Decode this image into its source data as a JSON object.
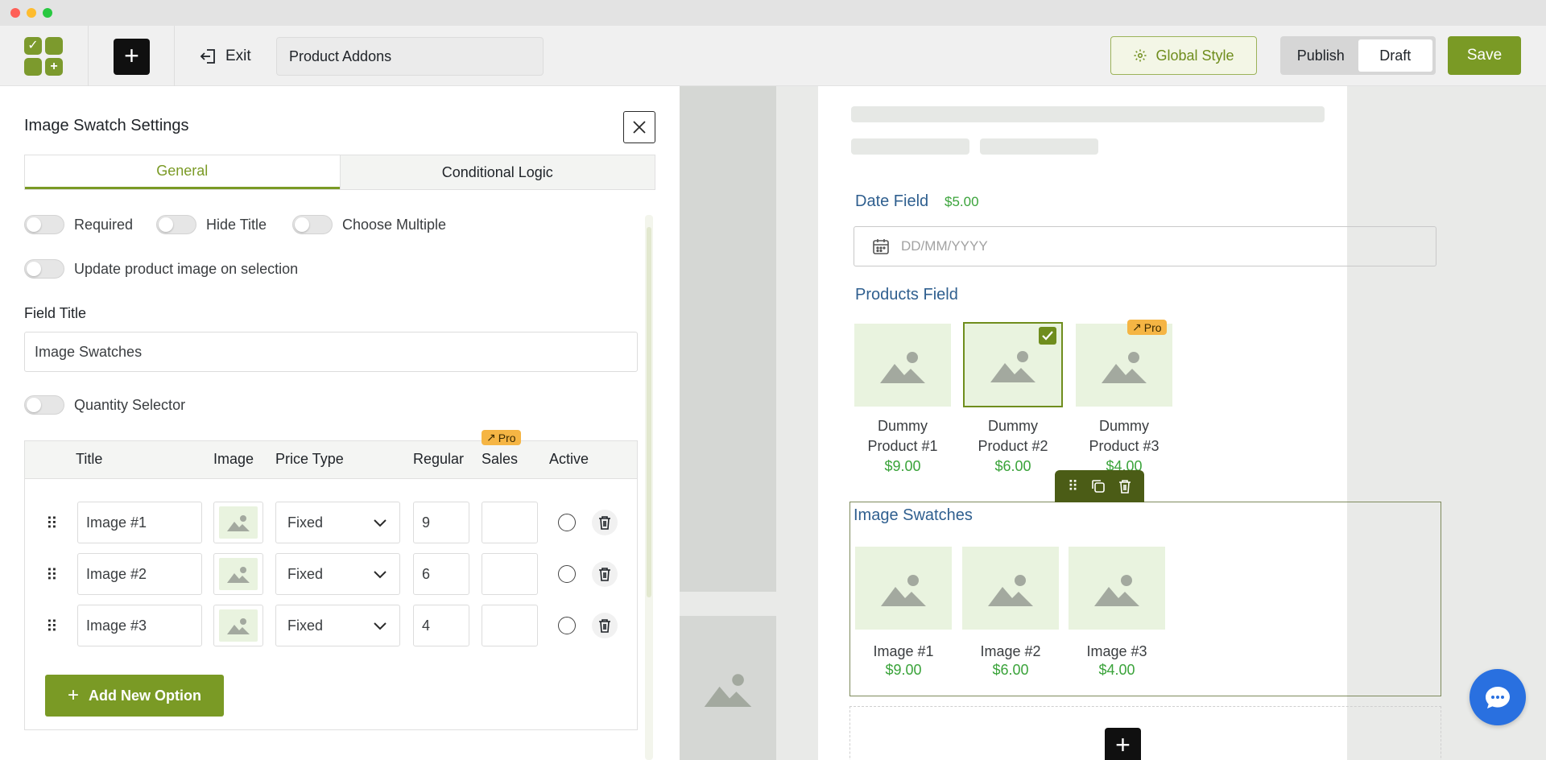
{
  "header": {
    "exit_label": "Exit",
    "title_value": "Product Addons",
    "global_style_label": "Global Style",
    "publish_label": "Publish",
    "draft_label": "Draft",
    "save_label": "Save"
  },
  "panel": {
    "title": "Image Swatch Settings",
    "tabs": [
      {
        "label": "General",
        "active": true
      },
      {
        "label": "Conditional Logic",
        "active": false
      }
    ],
    "toggles": {
      "required": "Required",
      "hide_title": "Hide Title",
      "choose_multiple": "Choose Multiple",
      "update_image": "Update product image on selection",
      "quantity_selector": "Quantity Selector"
    },
    "field_title_label": "Field Title",
    "field_title_value": "Image Swatches",
    "table": {
      "headers": {
        "title": "Title",
        "image": "Image",
        "price_type": "Price Type",
        "regular": "Regular",
        "sales": "Sales",
        "active": "Active"
      },
      "pro_badge": "Pro",
      "rows": [
        {
          "title": "Image #1",
          "price_type": "Fixed",
          "regular": "9",
          "sales": ""
        },
        {
          "title": "Image #2",
          "price_type": "Fixed",
          "regular": "6",
          "sales": ""
        },
        {
          "title": "Image #3",
          "price_type": "Fixed",
          "regular": "4",
          "sales": ""
        }
      ],
      "add_option_label": "Add New Option"
    }
  },
  "canvas": {
    "date_field": {
      "title": "Date Field",
      "price": "$5.00",
      "placeholder": "DD/MM/YYYY"
    },
    "products_field": {
      "title": "Products Field",
      "pro_badge": "Pro",
      "items": [
        {
          "name_line1": "Dummy",
          "name_line2": "Product #1",
          "price": "$9.00"
        },
        {
          "name_line1": "Dummy",
          "name_line2": "Product #2",
          "price": "$6.00",
          "selected": true
        },
        {
          "name_line1": "Dummy",
          "name_line2": "Product #3",
          "price": "$4.00"
        }
      ]
    },
    "image_swatches": {
      "title": "Image Swatches",
      "items": [
        {
          "name": "Image #1",
          "price": "$9.00"
        },
        {
          "name": "Image #2",
          "price": "$6.00"
        },
        {
          "name": "Image #3",
          "price": "$4.00"
        }
      ]
    }
  },
  "colors": {
    "accent": "#7a9a25",
    "price_green": "#3aa33a",
    "field_title_blue": "#2f5f8f",
    "pro_badge": "#f5b544",
    "chat_blue": "#2970e0"
  }
}
